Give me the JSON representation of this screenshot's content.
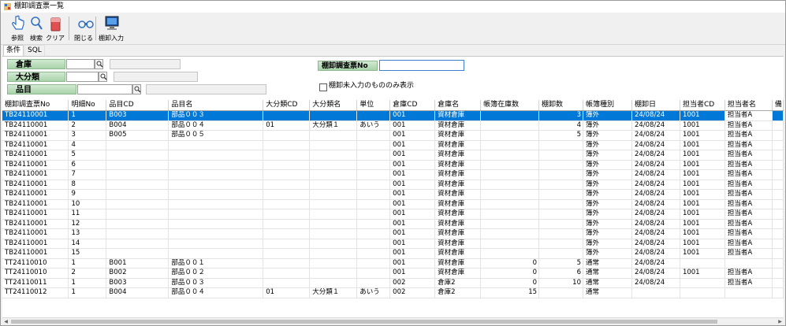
{
  "window": {
    "title": "棚卸調査票一覧"
  },
  "toolbar": {
    "buttons": [
      {
        "label": "参照",
        "icon": "hand-pointer-icon"
      },
      {
        "label": "検索",
        "icon": "magnifier-icon"
      },
      {
        "label": "クリア",
        "icon": "eraser-icon"
      },
      {
        "label": "閉じる",
        "icon": "binoculars-icon"
      },
      {
        "label": "棚卸入力",
        "icon": "computer-monitor-icon"
      }
    ]
  },
  "tabs": [
    {
      "label": "条件"
    },
    {
      "label": "SQL"
    }
  ],
  "conditions": {
    "warehouse_label": "倉庫",
    "category_label": "大分類",
    "item_label": "品目",
    "survey_no_label": "棚卸調査票No",
    "survey_no_value": "",
    "unentered_only_label": "棚卸未入力のもののみ表示",
    "unentered_only_checked": false
  },
  "grid": {
    "columns": [
      "棚卸調査票No",
      "明細No",
      "品目CD",
      "品目名",
      "大分類CD",
      "大分類名",
      "単位",
      "倉庫CD",
      "倉庫名",
      "帳簿在庫数",
      "棚卸数",
      "帳簿種別",
      "棚卸日",
      "担当者CD",
      "担当者名",
      "備"
    ],
    "rows": [
      [
        "TB24110001",
        "1",
        "B003",
        "部品００３",
        "",
        "",
        "",
        "001",
        "資材倉庫",
        "",
        "3",
        "簿外",
        "24/08/24",
        "1001",
        "担当者A",
        ""
      ],
      [
        "TB24110001",
        "2",
        "B004",
        "部品００４",
        "01",
        "大分類１",
        "あいう",
        "001",
        "資材倉庫",
        "",
        "4",
        "簿外",
        "24/08/24",
        "1001",
        "担当者A",
        ""
      ],
      [
        "TB24110001",
        "3",
        "B005",
        "部品００５",
        "",
        "",
        "",
        "001",
        "資材倉庫",
        "",
        "5",
        "簿外",
        "24/08/24",
        "1001",
        "担当者A",
        ""
      ],
      [
        "TB24110001",
        "4",
        "",
        "",
        "",
        "",
        "",
        "001",
        "資材倉庫",
        "",
        "",
        "簿外",
        "24/08/24",
        "1001",
        "担当者A",
        ""
      ],
      [
        "TB24110001",
        "5",
        "",
        "",
        "",
        "",
        "",
        "001",
        "資材倉庫",
        "",
        "",
        "簿外",
        "24/08/24",
        "1001",
        "担当者A",
        ""
      ],
      [
        "TB24110001",
        "6",
        "",
        "",
        "",
        "",
        "",
        "001",
        "資材倉庫",
        "",
        "",
        "簿外",
        "24/08/24",
        "1001",
        "担当者A",
        ""
      ],
      [
        "TB24110001",
        "7",
        "",
        "",
        "",
        "",
        "",
        "001",
        "資材倉庫",
        "",
        "",
        "簿外",
        "24/08/24",
        "1001",
        "担当者A",
        ""
      ],
      [
        "TB24110001",
        "8",
        "",
        "",
        "",
        "",
        "",
        "001",
        "資材倉庫",
        "",
        "",
        "簿外",
        "24/08/24",
        "1001",
        "担当者A",
        ""
      ],
      [
        "TB24110001",
        "9",
        "",
        "",
        "",
        "",
        "",
        "001",
        "資材倉庫",
        "",
        "",
        "簿外",
        "24/08/24",
        "1001",
        "担当者A",
        ""
      ],
      [
        "TB24110001",
        "10",
        "",
        "",
        "",
        "",
        "",
        "001",
        "資材倉庫",
        "",
        "",
        "簿外",
        "24/08/24",
        "1001",
        "担当者A",
        ""
      ],
      [
        "TB24110001",
        "11",
        "",
        "",
        "",
        "",
        "",
        "001",
        "資材倉庫",
        "",
        "",
        "簿外",
        "24/08/24",
        "1001",
        "担当者A",
        ""
      ],
      [
        "TB24110001",
        "12",
        "",
        "",
        "",
        "",
        "",
        "001",
        "資材倉庫",
        "",
        "",
        "簿外",
        "24/08/24",
        "1001",
        "担当者A",
        ""
      ],
      [
        "TB24110001",
        "13",
        "",
        "",
        "",
        "",
        "",
        "001",
        "資材倉庫",
        "",
        "",
        "簿外",
        "24/08/24",
        "1001",
        "担当者A",
        ""
      ],
      [
        "TB24110001",
        "14",
        "",
        "",
        "",
        "",
        "",
        "001",
        "資材倉庫",
        "",
        "",
        "簿外",
        "24/08/24",
        "1001",
        "担当者A",
        ""
      ],
      [
        "TB24110001",
        "15",
        "",
        "",
        "",
        "",
        "",
        "001",
        "資材倉庫",
        "",
        "",
        "簿外",
        "24/08/24",
        "1001",
        "担当者A",
        ""
      ],
      [
        "TT24110010",
        "1",
        "B001",
        "部品００１",
        "",
        "",
        "",
        "001",
        "資材倉庫",
        "0",
        "5",
        "通常",
        "24/08/24",
        "",
        "",
        ""
      ],
      [
        "TT24110010",
        "2",
        "B002",
        "部品００２",
        "",
        "",
        "",
        "001",
        "資材倉庫",
        "0",
        "6",
        "通常",
        "24/08/24",
        "1001",
        "担当者A",
        ""
      ],
      [
        "TT24110011",
        "1",
        "B003",
        "部品００３",
        "",
        "",
        "",
        "002",
        "倉庫2",
        "0",
        "10",
        "通常",
        "24/08/24",
        "",
        "担当者A",
        ""
      ],
      [
        "TT24110012",
        "1",
        "B004",
        "部品００４",
        "01",
        "大分類１",
        "あいう",
        "002",
        "倉庫2",
        "15",
        "",
        "通常",
        "",
        "",
        "",
        ""
      ]
    ]
  },
  "colors": {
    "selection": "#0078d7",
    "label_green": "#a7d2a8"
  }
}
